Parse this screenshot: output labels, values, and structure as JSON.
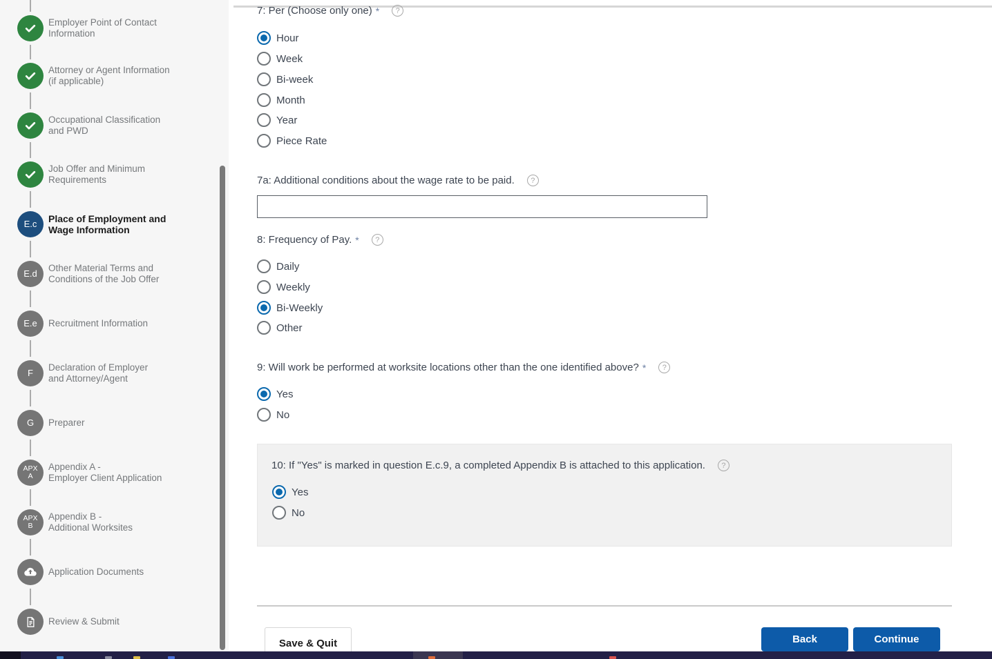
{
  "sidebar": {
    "steps": [
      {
        "label": "Employer Point of Contact\nInformation",
        "icon": "check",
        "state": "complete"
      },
      {
        "label": "Attorney or Agent Information\n(if applicable)",
        "icon": "check",
        "state": "complete"
      },
      {
        "label": "Occupational Classification\nand PWD",
        "icon": "check",
        "state": "complete"
      },
      {
        "label": "Job Offer and Minimum\nRequirements",
        "icon": "check",
        "state": "complete"
      },
      {
        "label": "Place of Employment and\nWage Information",
        "badge": "E.c",
        "state": "active"
      },
      {
        "label": "Other Material Terms and\nConditions of the Job Offer",
        "badge": "E.d",
        "state": "upcoming"
      },
      {
        "label": "Recruitment Information",
        "badge": "E.e",
        "state": "upcoming"
      },
      {
        "label": "Declaration of Employer\nand Attorney/Agent",
        "badge": "F",
        "state": "upcoming"
      },
      {
        "label": "Preparer",
        "badge": "G",
        "state": "upcoming"
      },
      {
        "label": "Appendix A -\nEmployer Client Application",
        "badge": "APX\nA",
        "state": "upcoming"
      },
      {
        "label": "Appendix B -\nAdditional Worksites",
        "badge": "APX\nB",
        "state": "upcoming"
      },
      {
        "label": "Application Documents",
        "icon": "cloud-upload",
        "state": "upcoming"
      },
      {
        "label": "Review & Submit",
        "icon": "document",
        "state": "upcoming"
      }
    ]
  },
  "main": {
    "q7": {
      "label": "7: Per (Choose only one)",
      "required": "*",
      "help_icon": "question-circle",
      "options": [
        "Hour",
        "Week",
        "Bi-week",
        "Month",
        "Year",
        "Piece Rate"
      ],
      "selected": "Hour"
    },
    "q7a": {
      "label": "7a: Additional conditions about the wage rate to be paid.",
      "help_icon": "question-circle",
      "value": "",
      "placeholder": ""
    },
    "q8": {
      "label": "8: Frequency of Pay.",
      "required": "*",
      "help_icon": "question-circle",
      "options": [
        "Daily",
        "Weekly",
        "Bi-Weekly",
        "Other"
      ],
      "selected": "Bi-Weekly"
    },
    "q9": {
      "label": "9: Will work be performed at worksite locations other than the one identified above?",
      "required": "*",
      "help_icon": "question-circle",
      "options": [
        "Yes",
        "No"
      ],
      "selected": "Yes"
    },
    "q10": {
      "label": "10: If \"Yes\" is marked in question E.c.9, a completed Appendix B is attached to this application.",
      "help_icon": "question-circle",
      "options": [
        "Yes",
        "No"
      ],
      "selected": "Yes"
    },
    "help_glyph": "?"
  },
  "footer": {
    "save_quit_label": "Save & Quit",
    "back_label": "Back",
    "continue_label": "Continue"
  },
  "colors": {
    "complete_green": "#2e8540",
    "active_step_blue": "#1d4e7e",
    "inactive_step_gray": "#757575",
    "radio_selected_blue": "#0b69ae",
    "button_blue": "#0d5ba9",
    "sidebar_background": "#f6f6f6",
    "panel_background": "#f1f1f1"
  }
}
